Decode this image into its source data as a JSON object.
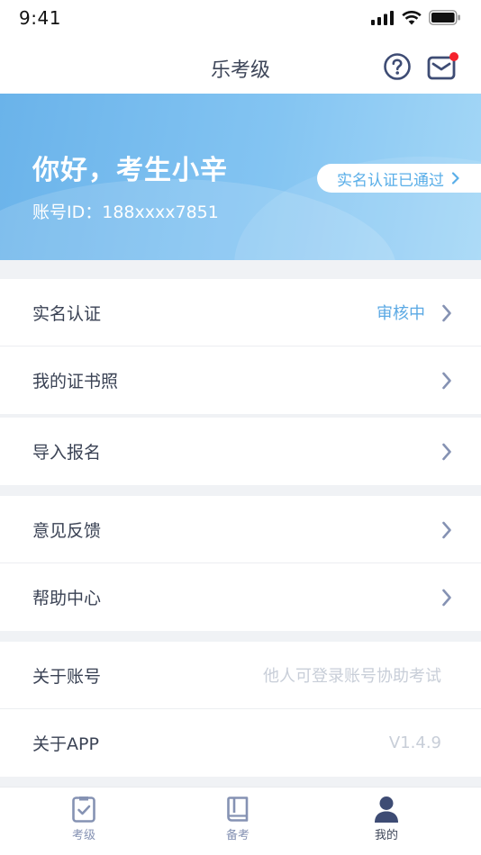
{
  "status_bar": {
    "time": "9:41"
  },
  "nav": {
    "title": "乐考级",
    "help_icon": "help-circle-icon",
    "mail_icon": "mail-icon",
    "mail_badge_color": "#f5222d"
  },
  "banner": {
    "greeting": "你好，考生小辛",
    "account_id": "账号ID：188xxxx7851",
    "verified_label": "实名认证已通过"
  },
  "menu": {
    "real_name": {
      "label": "实名认证",
      "status": "审核中"
    },
    "certificates": {
      "label": "我的证书照"
    },
    "import": {
      "label": "导入报名"
    },
    "feedback": {
      "label": "意见反馈"
    },
    "help": {
      "label": "帮助中心"
    },
    "about_account": {
      "label": "关于账号",
      "hint": "他人可登录账号协助考试"
    },
    "about_app": {
      "label": "关于APP",
      "version": "V1.4.9"
    }
  },
  "tabbar": {
    "items": [
      {
        "label": "考级",
        "icon": "exam-checklist-icon"
      },
      {
        "label": "备考",
        "icon": "book-icon"
      },
      {
        "label": "我的",
        "icon": "person-icon",
        "active": true
      }
    ]
  },
  "colors": {
    "accent": "#5ba9e4",
    "banner_start": "#6ab3ea",
    "banner_end": "#a4d7f6",
    "chevron": "#8592b3"
  }
}
